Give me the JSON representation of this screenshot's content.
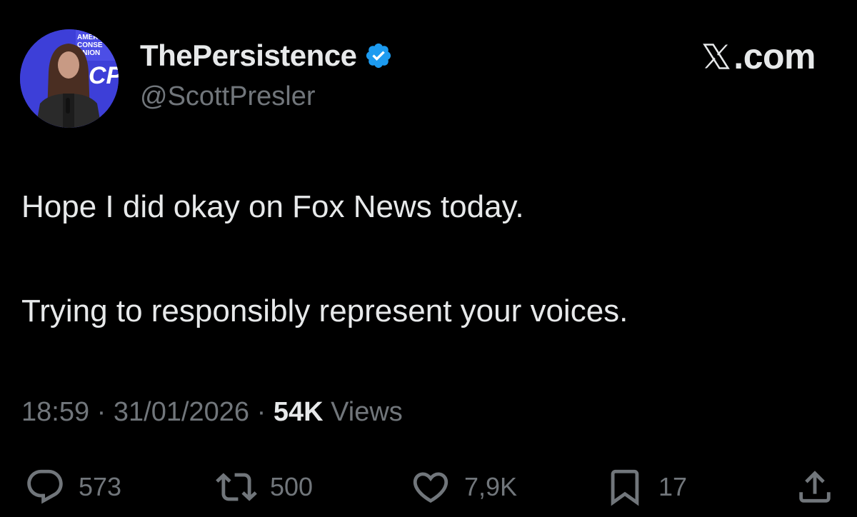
{
  "header": {
    "display_name": "ThePersistence",
    "handle": "@ScottPresler",
    "site": ".com",
    "avatar_sign_text": [
      "AMER",
      "CONSE",
      "UNION"
    ],
    "avatar_logo_text": "CPA"
  },
  "post": {
    "line1": "Hope I did okay on Fox News today.",
    "line2": "Trying to responsibly represent your voices."
  },
  "meta": {
    "time": "18:59",
    "date": "31/01/2026",
    "views_count": "54K",
    "views_label": "Views",
    "separator": "·"
  },
  "actions": {
    "replies": "573",
    "reposts": "500",
    "likes": "7,9K",
    "bookmarks": "17"
  },
  "colors": {
    "background": "#000000",
    "primary_text": "#e7e9ea",
    "secondary_text": "#71767b",
    "verified_badge": "#1d9bf0",
    "avatar_bg": "#3d3fd8"
  },
  "icons": [
    "verified-badge-icon",
    "x-logo-icon",
    "reply-icon",
    "retweet-icon",
    "like-icon",
    "bookmark-icon",
    "share-icon"
  ]
}
